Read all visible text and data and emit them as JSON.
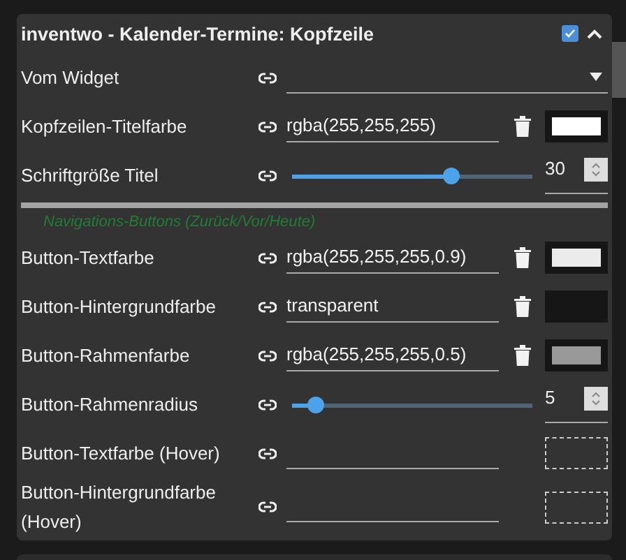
{
  "panel": {
    "title": "inventwo - Kalender-Termine: Kopfzeile",
    "checked": true,
    "expanded": true
  },
  "rows": [
    {
      "kind": "select",
      "label": "Vom Widget"
    },
    {
      "kind": "color",
      "label": "Kopfzeilen-Titelfarbe",
      "value": "rgba(255,255,255)",
      "color": "#ffffff"
    },
    {
      "kind": "slider",
      "label": "Schriftgröße Titel",
      "level": 0.66,
      "value": "30"
    },
    {
      "kind": "section",
      "label": "Navigations-Buttons (Zurück/Vor/Heute)"
    },
    {
      "kind": "color",
      "label": "Button-Textfarbe",
      "value": "rgba(255,255,255,0.9)",
      "color": "#ebebeb"
    },
    {
      "kind": "color",
      "label": "Button-Hintergrundfarbe",
      "value": "transparent",
      "color": "#161616"
    },
    {
      "kind": "color",
      "label": "Button-Rahmenfarbe",
      "value": "rgba(255,255,255,0.5)",
      "color": "#999999"
    },
    {
      "kind": "slider",
      "label": "Button-Rahmenradius",
      "level": 0.1,
      "value": "5"
    },
    {
      "kind": "color",
      "label": "Button-Textfarbe (Hover)"
    },
    {
      "kind": "color",
      "label": "Button-Hintergrundfarbe (Hover)"
    }
  ]
}
